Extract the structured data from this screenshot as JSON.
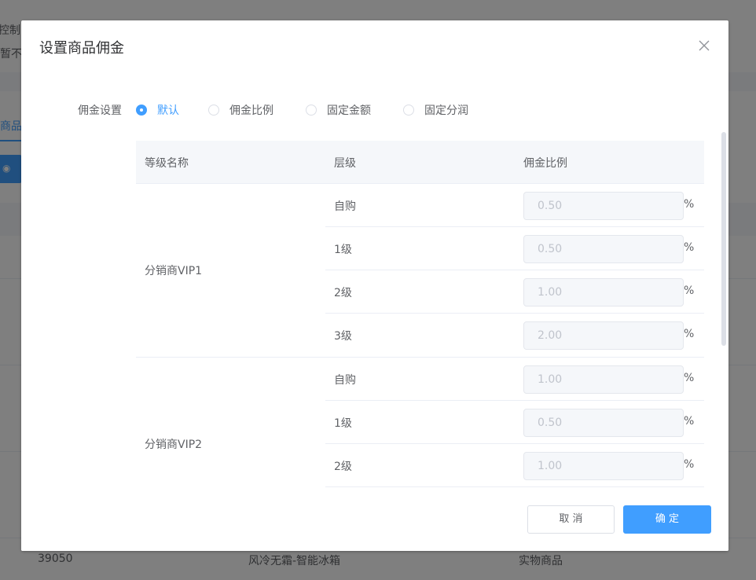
{
  "background": {
    "top_label": "控制",
    "top_value": "暂不",
    "tab_label": "商品",
    "button_icon": "eye-icon",
    "footer_row": {
      "id": "39050",
      "name": "风冷无霜-智能冰箱",
      "type": "实物商品"
    }
  },
  "dialog": {
    "title": "设置商品佣金",
    "close_icon": "close-icon",
    "form": {
      "label": "佣金设置",
      "options": [
        "默认",
        "佣金比例",
        "固定金额",
        "固定分润"
      ],
      "selected": "默认"
    },
    "table": {
      "columns": [
        "等级名称",
        "层级",
        "佣金比例"
      ],
      "unit": "%",
      "groups": [
        {
          "name": "分销商VIP1",
          "rows": [
            {
              "level": "自购",
              "value": "0.50"
            },
            {
              "level": "1级",
              "value": "0.50"
            },
            {
              "level": "2级",
              "value": "1.00"
            },
            {
              "level": "3级",
              "value": "2.00"
            }
          ]
        },
        {
          "name": "分销商VIP2",
          "rows": [
            {
              "level": "自购",
              "value": "1.00"
            },
            {
              "level": "1级",
              "value": "0.50"
            },
            {
              "level": "2级",
              "value": "1.00"
            }
          ]
        }
      ]
    },
    "footer": {
      "cancel": "取 消",
      "confirm": "确 定"
    }
  },
  "colors": {
    "primary": "#409eff",
    "overlay": "rgba(0,0,0,0.5)",
    "disabled_bg": "#f5f7fa"
  }
}
